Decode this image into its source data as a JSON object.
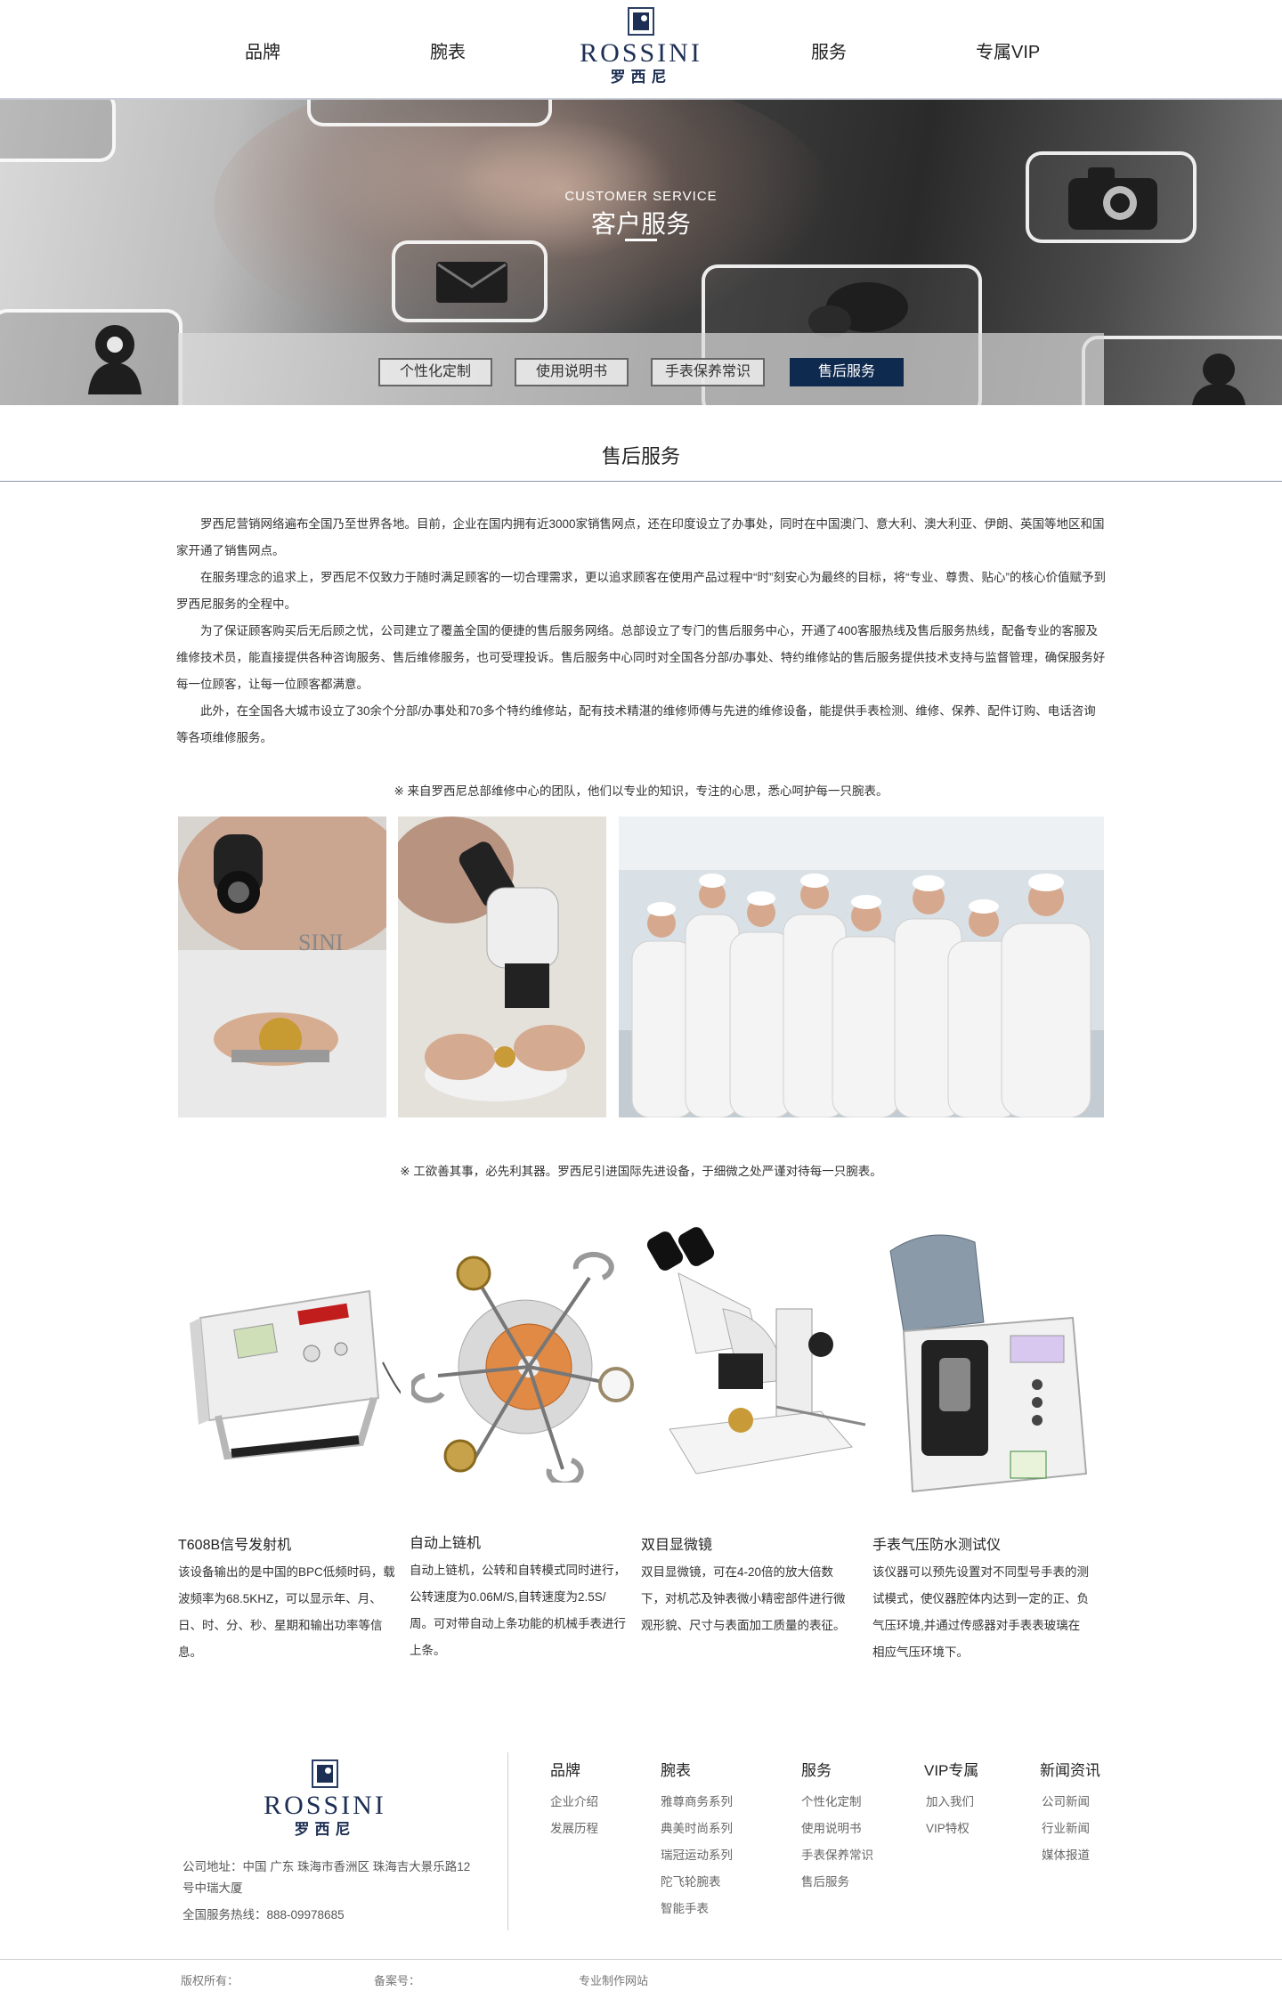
{
  "nav": {
    "items": [
      "品牌",
      "腕表",
      "服务",
      "专属VIP"
    ],
    "logo_en": "ROSSINI",
    "logo_cn": "罗西尼"
  },
  "banner": {
    "subtitle_en": "CUSTOMER SERVICE",
    "title_cn": "客户服务",
    "tabs": [
      {
        "label": "个性化定制",
        "active": false
      },
      {
        "label": "使用说明书",
        "active": false
      },
      {
        "label": "手表保养常识",
        "active": false
      },
      {
        "label": "售后服务",
        "active": true
      }
    ],
    "icons": [
      "user-icon",
      "mail-icon",
      "chat-icon",
      "camera-icon"
    ]
  },
  "section": {
    "title": "售后服务",
    "paragraphs": [
      "罗西尼营销网络遍布全国乃至世界各地。目前，企业在国内拥有近3000家销售网点，还在印度设立了办事处，同时在中国澳门、意大利、澳大利亚、伊朗、英国等地区和国家开通了销售网点。",
      "在服务理念的追求上，罗西尼不仅致力于随时满足顾客的一切合理需求，更以追求顾客在使用产品过程中“时”刻安心为最终的目标，将“专业、尊贵、贴心”的核心价值赋予到罗西尼服务的全程中。",
      "为了保证顾客购买后无后顾之忧，公司建立了覆盖全国的便捷的售后服务网络。总部设立了专门的售后服务中心，开通了400客服热线及售后服务热线，配备专业的客服及维修技术员，能直接提供各种咨询服务、售后维修服务，也可受理投诉。售后服务中心同时对全国各分部/办事处、特约维修站的售后服务提供技术支持与监督管理，确保服务好每一位顾客，让每一位顾客都满意。",
      "此外，在全国各大城市设立了30余个分部/办事处和70多个特约维修站，配有技术精湛的维修师傅与先进的维修设备，能提供手表检测、维修、保养、配件订购、电话咨询等各项维修服务。"
    ],
    "note1": "※ 来自罗西尼总部维修中心的团队，他们以专业的知识，专注的心思，悉心呵护每一只腕表。",
    "note2": "※ 工欲善其事，必先利其器。罗西尼引进国际先进设备，于细微之处严谨对待每一只腕表。"
  },
  "products": [
    {
      "title": "T608B信号发射机",
      "desc": "该设备输出的是中国的BPC低频时码，载波频率为68.5KHZ，可以显示年、月、日、时、分、秒、星期和输出功率等信息。",
      "icon": "signal-generator-icon"
    },
    {
      "title": "自动上链机",
      "desc": "自动上链机，公转和自转模式同时进行，公转速度为0.06M/S,自转速度为2.5S/周。可对带自动上条功能的机械手表进行上条。",
      "icon": "watch-winder-icon"
    },
    {
      "title": "双目显微镜",
      "desc": "双目显微镜，可在4-20倍的放大倍数下，对机芯及钟表微小精密部件进行微观形貌、尺寸与表面加工质量的表征。",
      "icon": "microscope-icon"
    },
    {
      "title": "手表气压防水测试仪",
      "desc": "该仪器可以预先设置对不同型号手表的测试模式，使仪器腔体内达到一定的正、负气压环境,并通过传感器对手表表玻璃在相应气压环境下。",
      "icon": "pressure-tester-icon"
    }
  ],
  "footer": {
    "logo_en": "ROSSINI",
    "logo_cn": "罗西尼",
    "address": "公司地址：中国 广东 珠海市香洲区 珠海吉大景乐路12号中瑞大厦",
    "hotline": "全国服务热线：888-09978685",
    "columns": [
      {
        "title": "品牌",
        "items": [
          "企业介绍",
          "发展历程"
        ]
      },
      {
        "title": "腕表",
        "items": [
          "雅尊商务系列",
          "典美时尚系列",
          "瑞冠运动系列",
          "陀飞轮腕表",
          "智能手表"
        ]
      },
      {
        "title": "服务",
        "items": [
          "个性化定制",
          "使用说明书",
          "手表保养常识",
          "售后服务"
        ]
      },
      {
        "title": "VIP专属",
        "items": [
          "加入我们",
          "VIP特权"
        ]
      },
      {
        "title": "新闻资讯",
        "items": [
          "公司新闻",
          "行业新闻",
          "媒体报道"
        ]
      }
    ],
    "copyright": "版权所有：",
    "icp": "备案号：",
    "maker": "专业制作网站"
  },
  "colors": {
    "accent": "#0f2a4f",
    "rule": "#8a98ad"
  }
}
